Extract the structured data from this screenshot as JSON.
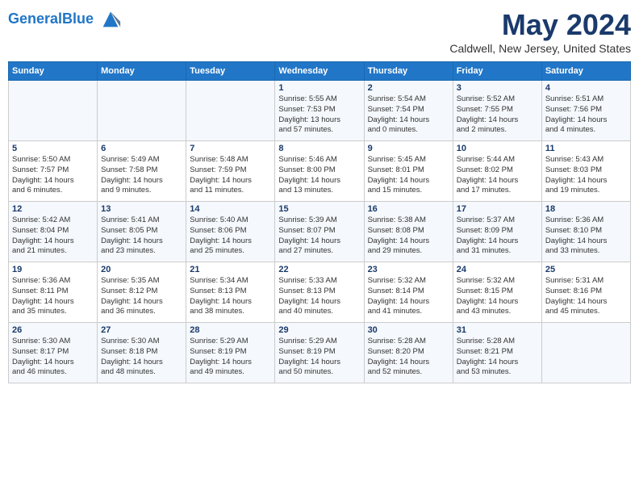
{
  "header": {
    "logo_line1": "General",
    "logo_line2": "Blue",
    "month_title": "May 2024",
    "location": "Caldwell, New Jersey, United States"
  },
  "weekdays": [
    "Sunday",
    "Monday",
    "Tuesday",
    "Wednesday",
    "Thursday",
    "Friday",
    "Saturday"
  ],
  "weeks": [
    [
      {
        "day": "",
        "info": ""
      },
      {
        "day": "",
        "info": ""
      },
      {
        "day": "",
        "info": ""
      },
      {
        "day": "1",
        "info": "Sunrise: 5:55 AM\nSunset: 7:53 PM\nDaylight: 13 hours\nand 57 minutes."
      },
      {
        "day": "2",
        "info": "Sunrise: 5:54 AM\nSunset: 7:54 PM\nDaylight: 14 hours\nand 0 minutes."
      },
      {
        "day": "3",
        "info": "Sunrise: 5:52 AM\nSunset: 7:55 PM\nDaylight: 14 hours\nand 2 minutes."
      },
      {
        "day": "4",
        "info": "Sunrise: 5:51 AM\nSunset: 7:56 PM\nDaylight: 14 hours\nand 4 minutes."
      }
    ],
    [
      {
        "day": "5",
        "info": "Sunrise: 5:50 AM\nSunset: 7:57 PM\nDaylight: 14 hours\nand 6 minutes."
      },
      {
        "day": "6",
        "info": "Sunrise: 5:49 AM\nSunset: 7:58 PM\nDaylight: 14 hours\nand 9 minutes."
      },
      {
        "day": "7",
        "info": "Sunrise: 5:48 AM\nSunset: 7:59 PM\nDaylight: 14 hours\nand 11 minutes."
      },
      {
        "day": "8",
        "info": "Sunrise: 5:46 AM\nSunset: 8:00 PM\nDaylight: 14 hours\nand 13 minutes."
      },
      {
        "day": "9",
        "info": "Sunrise: 5:45 AM\nSunset: 8:01 PM\nDaylight: 14 hours\nand 15 minutes."
      },
      {
        "day": "10",
        "info": "Sunrise: 5:44 AM\nSunset: 8:02 PM\nDaylight: 14 hours\nand 17 minutes."
      },
      {
        "day": "11",
        "info": "Sunrise: 5:43 AM\nSunset: 8:03 PM\nDaylight: 14 hours\nand 19 minutes."
      }
    ],
    [
      {
        "day": "12",
        "info": "Sunrise: 5:42 AM\nSunset: 8:04 PM\nDaylight: 14 hours\nand 21 minutes."
      },
      {
        "day": "13",
        "info": "Sunrise: 5:41 AM\nSunset: 8:05 PM\nDaylight: 14 hours\nand 23 minutes."
      },
      {
        "day": "14",
        "info": "Sunrise: 5:40 AM\nSunset: 8:06 PM\nDaylight: 14 hours\nand 25 minutes."
      },
      {
        "day": "15",
        "info": "Sunrise: 5:39 AM\nSunset: 8:07 PM\nDaylight: 14 hours\nand 27 minutes."
      },
      {
        "day": "16",
        "info": "Sunrise: 5:38 AM\nSunset: 8:08 PM\nDaylight: 14 hours\nand 29 minutes."
      },
      {
        "day": "17",
        "info": "Sunrise: 5:37 AM\nSunset: 8:09 PM\nDaylight: 14 hours\nand 31 minutes."
      },
      {
        "day": "18",
        "info": "Sunrise: 5:36 AM\nSunset: 8:10 PM\nDaylight: 14 hours\nand 33 minutes."
      }
    ],
    [
      {
        "day": "19",
        "info": "Sunrise: 5:36 AM\nSunset: 8:11 PM\nDaylight: 14 hours\nand 35 minutes."
      },
      {
        "day": "20",
        "info": "Sunrise: 5:35 AM\nSunset: 8:12 PM\nDaylight: 14 hours\nand 36 minutes."
      },
      {
        "day": "21",
        "info": "Sunrise: 5:34 AM\nSunset: 8:13 PM\nDaylight: 14 hours\nand 38 minutes."
      },
      {
        "day": "22",
        "info": "Sunrise: 5:33 AM\nSunset: 8:13 PM\nDaylight: 14 hours\nand 40 minutes."
      },
      {
        "day": "23",
        "info": "Sunrise: 5:32 AM\nSunset: 8:14 PM\nDaylight: 14 hours\nand 41 minutes."
      },
      {
        "day": "24",
        "info": "Sunrise: 5:32 AM\nSunset: 8:15 PM\nDaylight: 14 hours\nand 43 minutes."
      },
      {
        "day": "25",
        "info": "Sunrise: 5:31 AM\nSunset: 8:16 PM\nDaylight: 14 hours\nand 45 minutes."
      }
    ],
    [
      {
        "day": "26",
        "info": "Sunrise: 5:30 AM\nSunset: 8:17 PM\nDaylight: 14 hours\nand 46 minutes."
      },
      {
        "day": "27",
        "info": "Sunrise: 5:30 AM\nSunset: 8:18 PM\nDaylight: 14 hours\nand 48 minutes."
      },
      {
        "day": "28",
        "info": "Sunrise: 5:29 AM\nSunset: 8:19 PM\nDaylight: 14 hours\nand 49 minutes."
      },
      {
        "day": "29",
        "info": "Sunrise: 5:29 AM\nSunset: 8:19 PM\nDaylight: 14 hours\nand 50 minutes."
      },
      {
        "day": "30",
        "info": "Sunrise: 5:28 AM\nSunset: 8:20 PM\nDaylight: 14 hours\nand 52 minutes."
      },
      {
        "day": "31",
        "info": "Sunrise: 5:28 AM\nSunset: 8:21 PM\nDaylight: 14 hours\nand 53 minutes."
      },
      {
        "day": "",
        "info": ""
      }
    ]
  ]
}
